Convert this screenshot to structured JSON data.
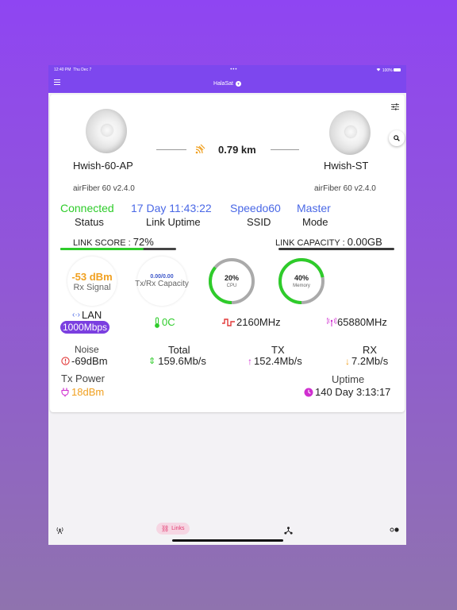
{
  "status_bar": {
    "time": "12:40 PM",
    "date": "Thu Dec 7",
    "dots": "•••",
    "battery": "100%"
  },
  "nav": {
    "title": "HalaSat"
  },
  "link": {
    "ap_name": "Hwish-60-AP",
    "ap_firmware": "airFiber 60 v2.4.0",
    "st_name": "Hwish-ST",
    "st_firmware": "airFiber 60 v2.4.0",
    "distance": "0.79 km"
  },
  "status_row": {
    "status_value": "Connected",
    "status_label": "Status",
    "uptime_value": "17 Day 11:43:22",
    "uptime_label": "Link Uptime",
    "ssid_value": "Speedo60",
    "ssid_label": "SSID",
    "mode_value": "Master",
    "mode_label": "Mode"
  },
  "link_score": {
    "label": "LINK SCORE : ",
    "value": "72%",
    "fraction": 0.72
  },
  "link_capacity": {
    "label": "LINK CAPACITY : ",
    "value": "0.00GB",
    "fraction": 1.0
  },
  "metrics": {
    "rx_signal_value": "-53 dBm",
    "rx_signal_label": "Rx Signal",
    "txrx_value": "0.00/0.00",
    "txrx_label": "Tx/Rx Capacity",
    "cpu_value": "20%",
    "cpu_label": "CPU",
    "cpu_fraction": 0.2,
    "memory_value": "40%",
    "memory_label": "Memory",
    "memory_fraction": 0.4
  },
  "info_row": {
    "lan_label": "LAN",
    "lan_value": "1000Mbps",
    "temperature": "0C",
    "frequency": "2160MHz",
    "rf_frequency": "65880MHz"
  },
  "stats": {
    "noise_label": "Noise",
    "noise_value": "-69dBm",
    "total_label": "Total",
    "total_value": "159.6Mb/s",
    "tx_label": "TX",
    "tx_value": "152.4Mb/s",
    "rx_label": "RX",
    "rx_value": "7.2Mb/s",
    "txpower_label": "Tx Power",
    "txpower_value": "18dBm",
    "uptime_label": "Uptime",
    "uptime_value": "140 Day 3:13:17"
  },
  "tabs": {
    "links_label": "Links"
  },
  "colors": {
    "accent": "#7d47ee",
    "green": "#2ecc2a",
    "blue": "#4a68e6",
    "orange": "#f0a020",
    "red": "#e23838",
    "magenta": "#d02fd0",
    "gray": "#aaaaaa"
  }
}
